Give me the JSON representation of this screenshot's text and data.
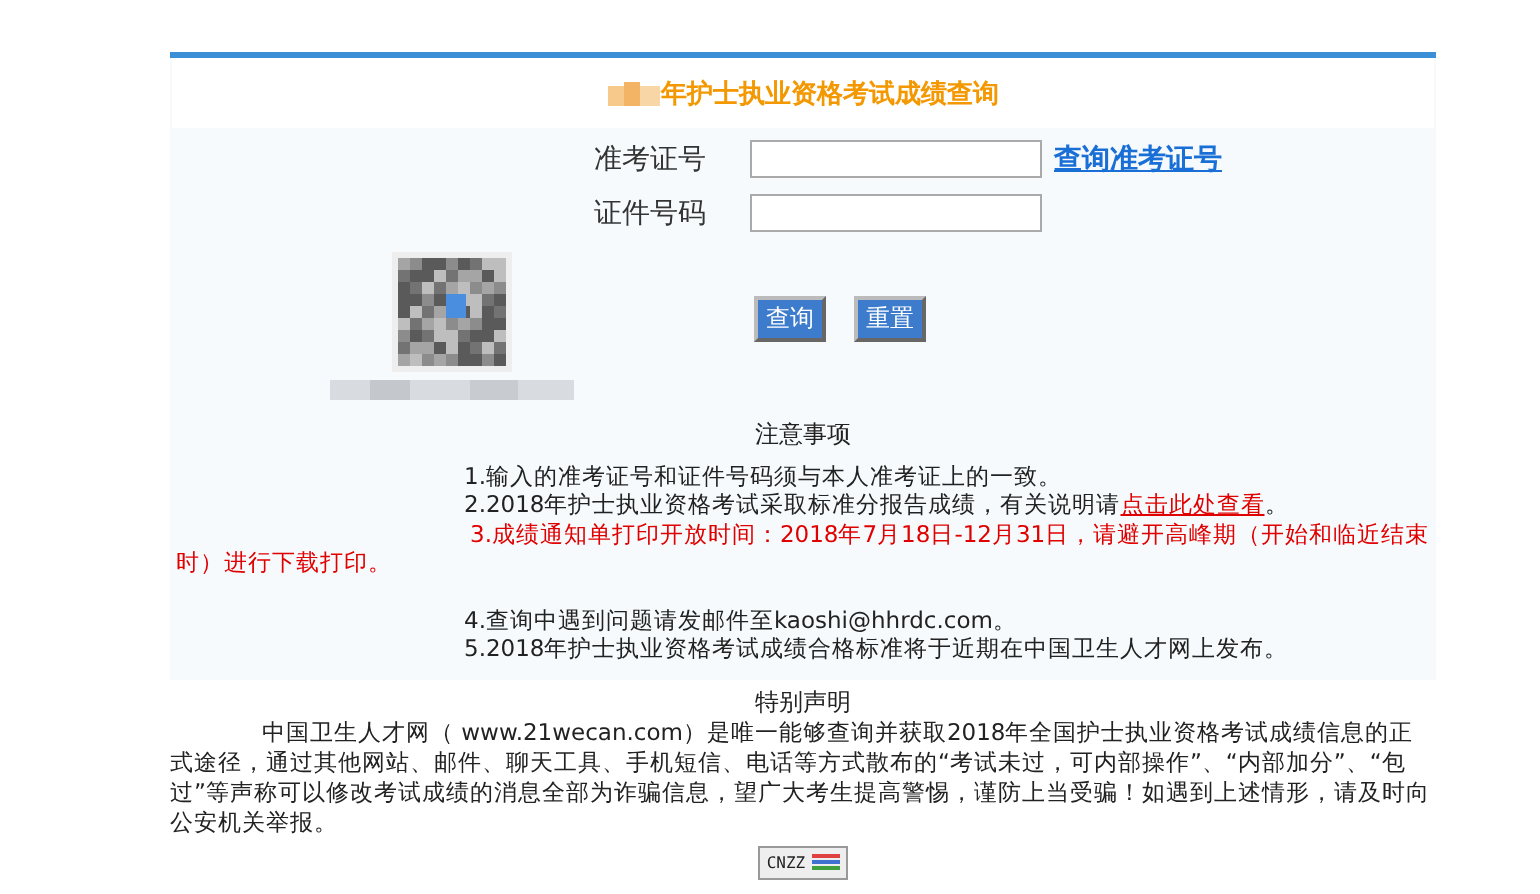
{
  "header": {
    "title": "年护士执业资格考试成绩查询"
  },
  "form": {
    "fields": [
      {
        "label": "准考证号",
        "link": "查询准考证号"
      },
      {
        "label": "证件号码"
      }
    ],
    "buttons": [
      "查询",
      "重置"
    ]
  },
  "notice": {
    "title": "注意事项",
    "items": [
      {
        "text": "1.输入的准考证号和证件号码须与本人准考证上的一致。",
        "kind": "plain"
      },
      {
        "text": "2.2018年护士执业资格考试采取标准分报告成绩，有关说明请",
        "link": "点击此处查看",
        "after": "。",
        "kind": "link"
      },
      {
        "text": "3.成绩通知单打印开放时间：2018年7月18日-12月31日，请避开高峰期（开始和临近结束时）进行下载打印。",
        "kind": "warning"
      },
      {
        "text": "4.查询中遇到问题请发邮件至kaoshi@hhrdc.com。",
        "kind": "plain"
      },
      {
        "text": "5.2018年护士执业资格考试成绩合格标准将于近期在中国卫生人才网上发布。",
        "kind": "plain"
      }
    ]
  },
  "statement": {
    "title": "特别声明",
    "text": "中国卫生人才网（ www.21wecan.com）是唯一能够查询并获取2018年全国护士执业资格考试成绩信息的正式途径，通过其他网站、邮件、聊天工具、手机短信、电话等方式散布的“考试未过，可内部操作”、“内部加分”、“包过”等声称可以修改考试成绩的消息全部为诈骗信息，望广大考生提高警惕，谨防上当受骗！如遇到上述情形，请及时向公安机关举报。"
  },
  "counter": {
    "label": "CNZZ"
  }
}
